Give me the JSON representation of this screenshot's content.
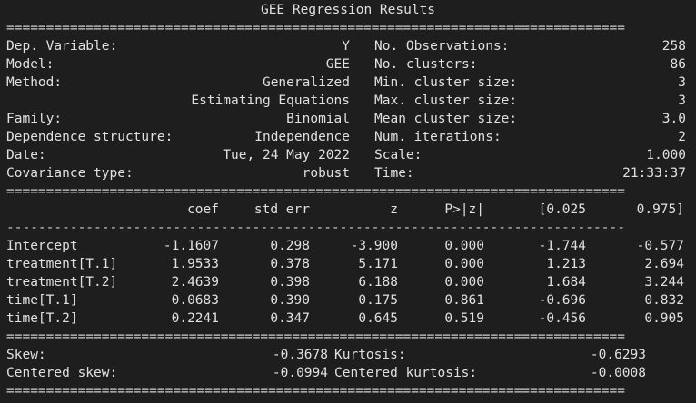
{
  "title": "GEE Regression Results",
  "rules": {
    "double_long": "==============================================================================",
    "single_long": "------------------------------------------------------------------------------",
    "double_short": "==============================================================================",
    "dash_short": "--------------------------------------------------------------------------------"
  },
  "summary_left": [
    {
      "label": "Dep. Variable:",
      "value": "Y"
    },
    {
      "label": "Model:",
      "value": "GEE"
    },
    {
      "label": "Method:",
      "value": "Generalized"
    },
    {
      "label": "",
      "value": "Estimating Equations"
    },
    {
      "label": "Family:",
      "value": "Binomial"
    },
    {
      "label": "Dependence structure:",
      "value": "Independence"
    },
    {
      "label": "Date:",
      "value": "Tue, 24 May 2022"
    },
    {
      "label": "Covariance type:",
      "value": "robust"
    }
  ],
  "summary_right": [
    {
      "label": "No. Observations:",
      "value": "258"
    },
    {
      "label": "No. clusters:",
      "value": "86"
    },
    {
      "label": "Min. cluster size:",
      "value": "3"
    },
    {
      "label": "Max. cluster size:",
      "value": "3"
    },
    {
      "label": "Mean cluster size:",
      "value": "3.0"
    },
    {
      "label": "Num. iterations:",
      "value": "2"
    },
    {
      "label": "Scale:",
      "value": "1.000"
    },
    {
      "label": "Time:",
      "value": "21:33:37"
    }
  ],
  "coef_table": {
    "headers": [
      "coef",
      "std err",
      "z",
      "P>|z|",
      "[0.025",
      "0.975]"
    ],
    "rows": [
      {
        "name": "Intercept",
        "cells": [
          "-1.1607",
          "0.298",
          "-3.900",
          "0.000",
          "-1.744",
          "-0.577"
        ]
      },
      {
        "name": "treatment[T.1]",
        "cells": [
          "1.9533",
          "0.378",
          "5.171",
          "0.000",
          "1.213",
          "2.694"
        ]
      },
      {
        "name": "treatment[T.2]",
        "cells": [
          "2.4639",
          "0.398",
          "6.188",
          "0.000",
          "1.684",
          "3.244"
        ]
      },
      {
        "name": "time[T.1]",
        "cells": [
          "0.0683",
          "0.390",
          "0.175",
          "0.861",
          "-0.696",
          "0.832"
        ]
      },
      {
        "name": "time[T.2]",
        "cells": [
          "0.2241",
          "0.347",
          "0.645",
          "0.519",
          "-0.456",
          "0.905"
        ]
      }
    ]
  },
  "diagnostics": [
    {
      "label": "Skew:",
      "value": "-0.3678",
      "label2": "Kurtosis:",
      "value2": "-0.6293"
    },
    {
      "label": "Centered skew:",
      "value": "-0.0994",
      "label2": "Centered kurtosis:",
      "value2": "-0.0008"
    }
  ]
}
